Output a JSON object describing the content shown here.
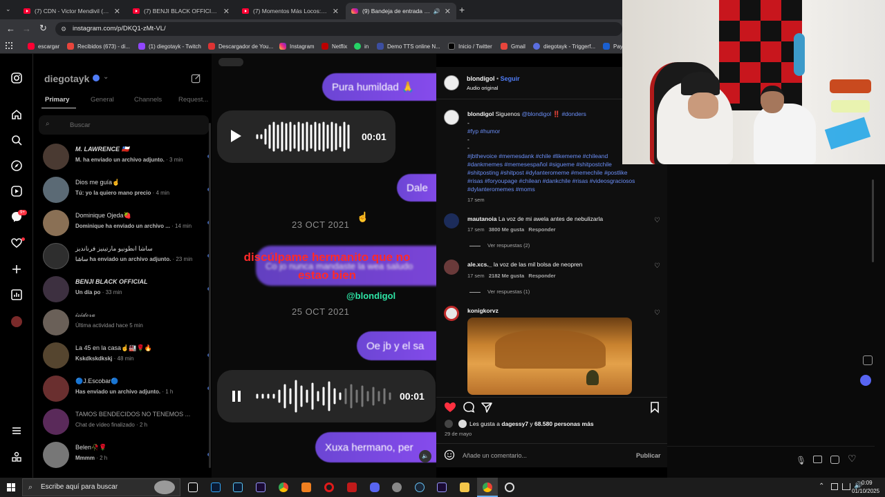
{
  "browser": {
    "tabs": [
      {
        "title": "(7) CDN - Victor Mendivil (Offic",
        "active": false
      },
      {
        "title": "(7) BENJI BLACK OFFICIAL - You",
        "active": false
      },
      {
        "title": "(7) Momentos Más Locos: Polic",
        "active": false
      },
      {
        "title": "(9) Bandeja de entrada • Ch",
        "active": true
      }
    ],
    "url": "instagram.com/p/DKQ1-zMt-VL/",
    "bookmarks": [
      "escargar",
      "Recibidos (673) - di...",
      "(1) diegotayk - Twitch",
      "Descargador de You...",
      "Instagram",
      "Netflix",
      "in",
      "Demo TTS online N...",
      "Inicio / Twitter",
      "Gmail",
      "diegotayk - Triggerf...",
      "Pay"
    ]
  },
  "dm": {
    "account": "diegotayk",
    "tabs": [
      "Primary",
      "General",
      "Channels",
      "Request..."
    ],
    "search_placeholder": "Buscar",
    "rail_badge": "9+",
    "threads": [
      {
        "name": "M. LAWRENCE 🇨🇱",
        "preview": "M. ha enviado un archivo adjunto.",
        "time": "· 3 min",
        "unread": true
      },
      {
        "name": "Dios me guía☝️",
        "preview": "Tú: yo la quiero mano precio",
        "time": "· 4 min",
        "unread": true
      },
      {
        "name": "Dominique Ojeda🍓",
        "preview": "Dominique ha enviado un archivo ...",
        "time": "· 14 min",
        "unread": true
      },
      {
        "name": "ساشا انطونيو مارتينيز فرنانديز",
        "preview": "ساشا ha enviado un archivo adjunto.",
        "time": "· 23 min",
        "unread": true
      },
      {
        "name": "BENJI BLACK OFFICIAL",
        "preview": "Un día po",
        "time": "· 33 min",
        "unread": true
      },
      {
        "name": "𝓲𝓼𝓲𝓭𝓸𝓻𝓪",
        "preview": "Última actividad hace 5 min",
        "time": "",
        "unread": false
      },
      {
        "name": "La 45 en la casa☝️🏭🌹🔥",
        "preview": "Kskdkskdkskj",
        "time": "· 48 min",
        "unread": true
      },
      {
        "name": "🔵J.Escobar🔵",
        "preview": "Has enviado un archivo adjunto.",
        "time": "· 1 h",
        "unread": true
      },
      {
        "name": "TAMOS BENDECIDOS NO TENEMOS ...",
        "preview": "Chat de vídeo finalizado",
        "time": "· 2 h",
        "unread": false
      },
      {
        "name": "Belen🥀🌹",
        "preview": "Mmmm",
        "time": "· 2 h",
        "unread": true
      }
    ]
  },
  "video": {
    "bubbles": [
      "Pura humildad 🙏",
      "Dale",
      "Oe jb y el sa",
      "Xuxa hermano, per"
    ],
    "blurred_received": "Co jo nunca mandaste la wea saludo",
    "audio_time_1": "00:01",
    "audio_time_2": "00:01",
    "dates": [
      "23 OCT 2021",
      "25 OCT 2021"
    ],
    "caption_red": "discúlpame hermanito que no estao bien",
    "watermark": "@blondigol"
  },
  "reel": {
    "author": "blondigol",
    "follow": "Seguir",
    "audio": "Audio original",
    "caption_author": "blondigol",
    "caption_text": "Siguenos ",
    "caption_mention": "@blondigol",
    "caption_emoji": "‼️",
    "caption_tag1": "#donders",
    "dash": "-",
    "caption_tags2": "#fyp #humor",
    "caption_tags3": "#jbthevoice #memesdank #chile #likememe #chileand",
    "caption_tags4": "#dankmemes #memesespañol #sigueme #shitpostchile",
    "caption_tags5": "#shitposting #shitpost #dylanteromeme #memechile #postlike",
    "caption_tags6": "#risas #foryoupage #chilean #dankchile #risas #videosgraciosos",
    "caption_tags7": "#dylanteromemes #moms",
    "caption_time": "17 sem",
    "comments": [
      {
        "user": "mautanoia",
        "text": "La voz de mi awela antes de nebulizarla",
        "time": "17 sem",
        "likes": "3800 Me gusta",
        "reply": "Responder",
        "replies": "Ver respuestas (2)"
      },
      {
        "user": "ale.xcs._",
        "text": "la voz de las mil bolsa de neopren",
        "time": "17 sem",
        "likes": "2182 Me gusta",
        "reply": "Responder",
        "replies": "Ver respuestas (1)"
      },
      {
        "user": "konigkorvz",
        "text": ""
      }
    ],
    "likes_line_prefix": "Les gusta a ",
    "likes_user": "dagessy7",
    "likes_mid": " y ",
    "likes_count": "68.580 personas más",
    "date": "29 de mayo",
    "comment_placeholder": "Añade un comentario...",
    "publish": "Publicar"
  },
  "taskbar": {
    "search_placeholder": "Escribe aquí para buscar",
    "time": "0:09",
    "date": "01/10/2025"
  },
  "colors": {
    "ig_blue": "#4f7cf6",
    "bubble": "#7a4ae6",
    "like_red": "#ff3040"
  }
}
